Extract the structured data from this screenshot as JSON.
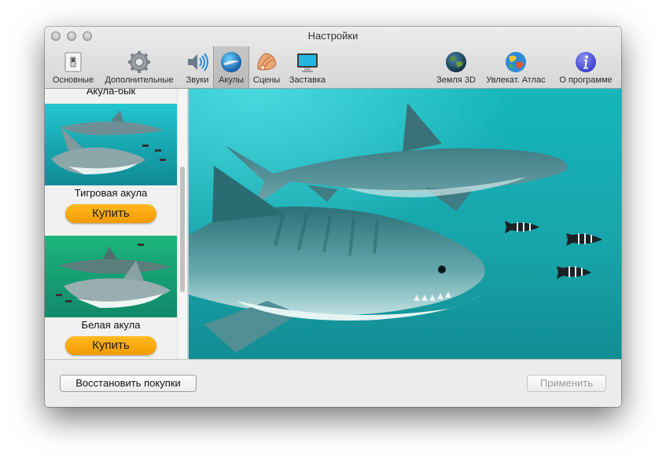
{
  "window": {
    "title": "Настройки"
  },
  "toolbar": {
    "items": [
      {
        "label": "Основные",
        "icon": "switch-icon"
      },
      {
        "label": "Дополнительные",
        "icon": "gear-icon"
      },
      {
        "label": "Звуки",
        "icon": "speaker-icon"
      },
      {
        "label": "Акулы",
        "icon": "shark-globe-icon"
      },
      {
        "label": "Сцены",
        "icon": "shell-icon"
      },
      {
        "label": "Заставка",
        "icon": "monitor-icon"
      },
      {
        "label": "Земля 3D",
        "icon": "earth-icon"
      },
      {
        "label": "Увлекат. Атлас",
        "icon": "atlas-globe-icon"
      },
      {
        "label": "О программе",
        "icon": "info-icon"
      }
    ],
    "selected": "Акулы"
  },
  "sidebar": {
    "items": [
      {
        "title": "Акула-бык"
      },
      {
        "title": "Тигровая акула",
        "button": "Купить"
      },
      {
        "title": "Белая акула",
        "button": "Купить"
      }
    ]
  },
  "footer": {
    "restore_label": "Восстановить покупки",
    "apply_label": "Применить"
  },
  "colors": {
    "accent": "#f6a400",
    "water": "#1aa3aa"
  }
}
